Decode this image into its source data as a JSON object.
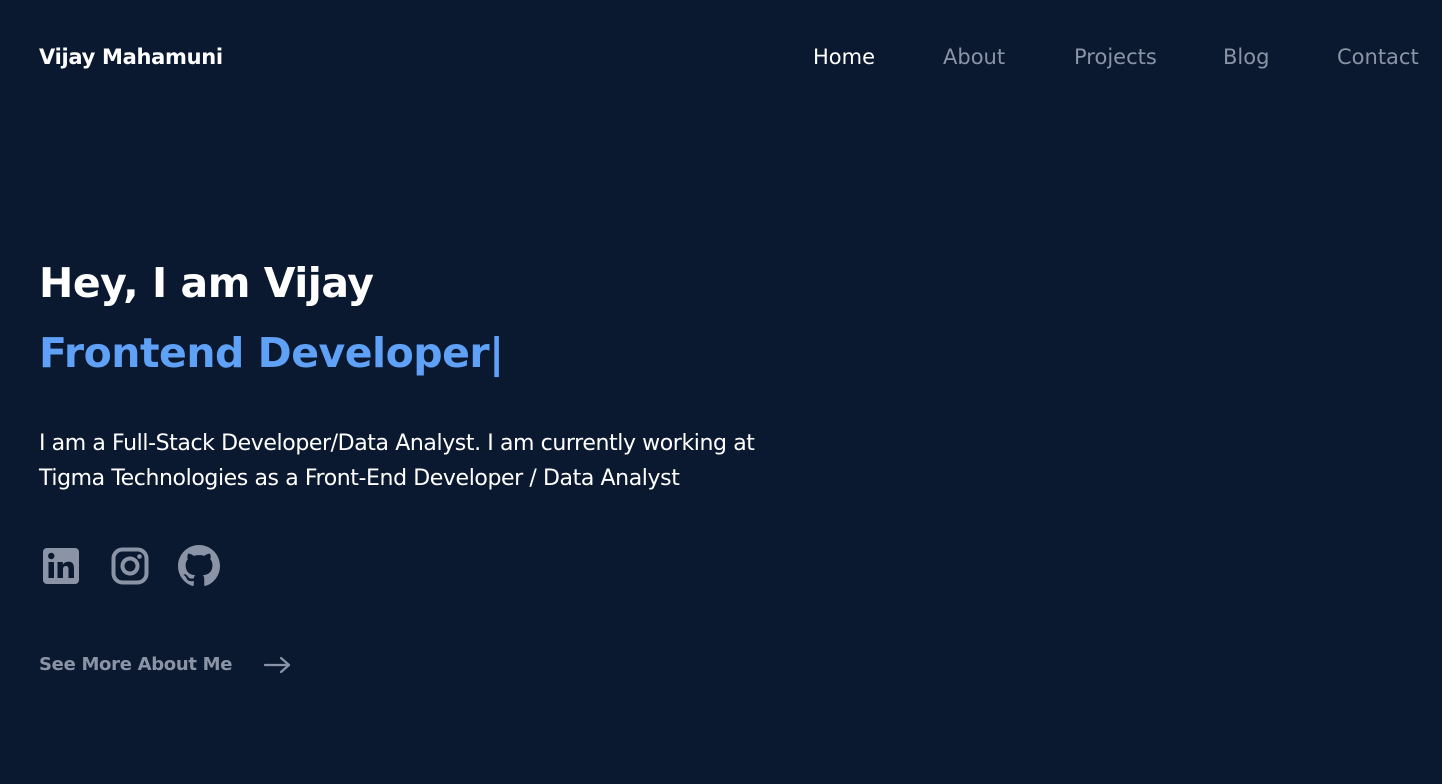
{
  "header": {
    "brand": "Vijay Mahamuni",
    "nav": [
      {
        "label": "Home",
        "active": true
      },
      {
        "label": "About",
        "active": false
      },
      {
        "label": "Projects",
        "active": false
      },
      {
        "label": "Blog",
        "active": false
      },
      {
        "label": "Contact",
        "active": false
      }
    ]
  },
  "hero": {
    "greeting": "Hey, I am Vijay",
    "role": "Frontend Developer|",
    "description": "I am a Full-Stack Developer/Data Analyst. I am currently working at Tigma Technologies as a Front-End Developer / Data Analyst",
    "socials": [
      {
        "icon": "linkedin-icon"
      },
      {
        "icon": "instagram-icon"
      },
      {
        "icon": "github-icon"
      }
    ],
    "cta": {
      "label": "See More About Me",
      "icon": "arrow-right-icon"
    }
  },
  "colors": {
    "background": "#0b1930",
    "accent": "#5fa1f6",
    "muted": "#8a94a6",
    "text": "#ffffff"
  }
}
